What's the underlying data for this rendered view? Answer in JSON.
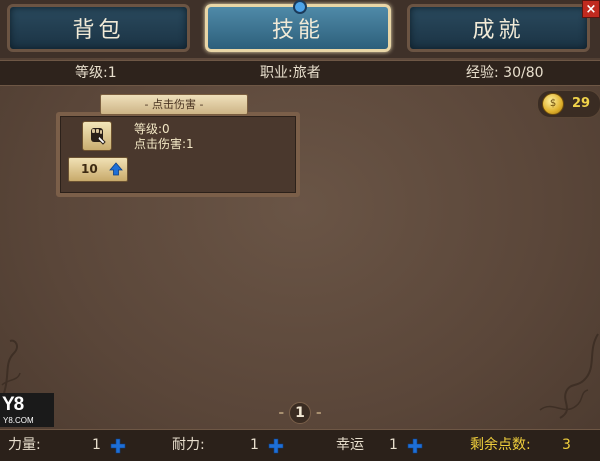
{
  "tabs": [
    {
      "label": "背包",
      "active": false
    },
    {
      "label": "技能",
      "active": true
    },
    {
      "label": "成就",
      "active": false
    }
  ],
  "close_label": "×",
  "stats": {
    "level": "等级:1",
    "class": "职业:旅者",
    "exp": "经验: 30/80"
  },
  "gold": {
    "value": "29",
    "icon": "gold-coin-icon"
  },
  "skill": {
    "tag": "- 点击伤害 -",
    "level": "等级:0",
    "damage": "点击伤害:1",
    "upgrade_cost": "10",
    "icon": "fist-icon"
  },
  "page": "1",
  "logo": {
    "main": "Y8",
    "sub": "Y8.COM"
  },
  "attributes": [
    {
      "label": "力量:",
      "value": "1"
    },
    {
      "label": "耐力:",
      "value": "1"
    },
    {
      "label": "幸运",
      "value": "1"
    }
  ],
  "points": {
    "label": "剩余点数:",
    "value": "3"
  },
  "colors": {
    "background": "#5e4a3d",
    "active_tab": "#3f7596",
    "gold_text": "#f0cf3c",
    "plus_blue": "#1e6fd6",
    "close_red": "#c02a1f"
  }
}
